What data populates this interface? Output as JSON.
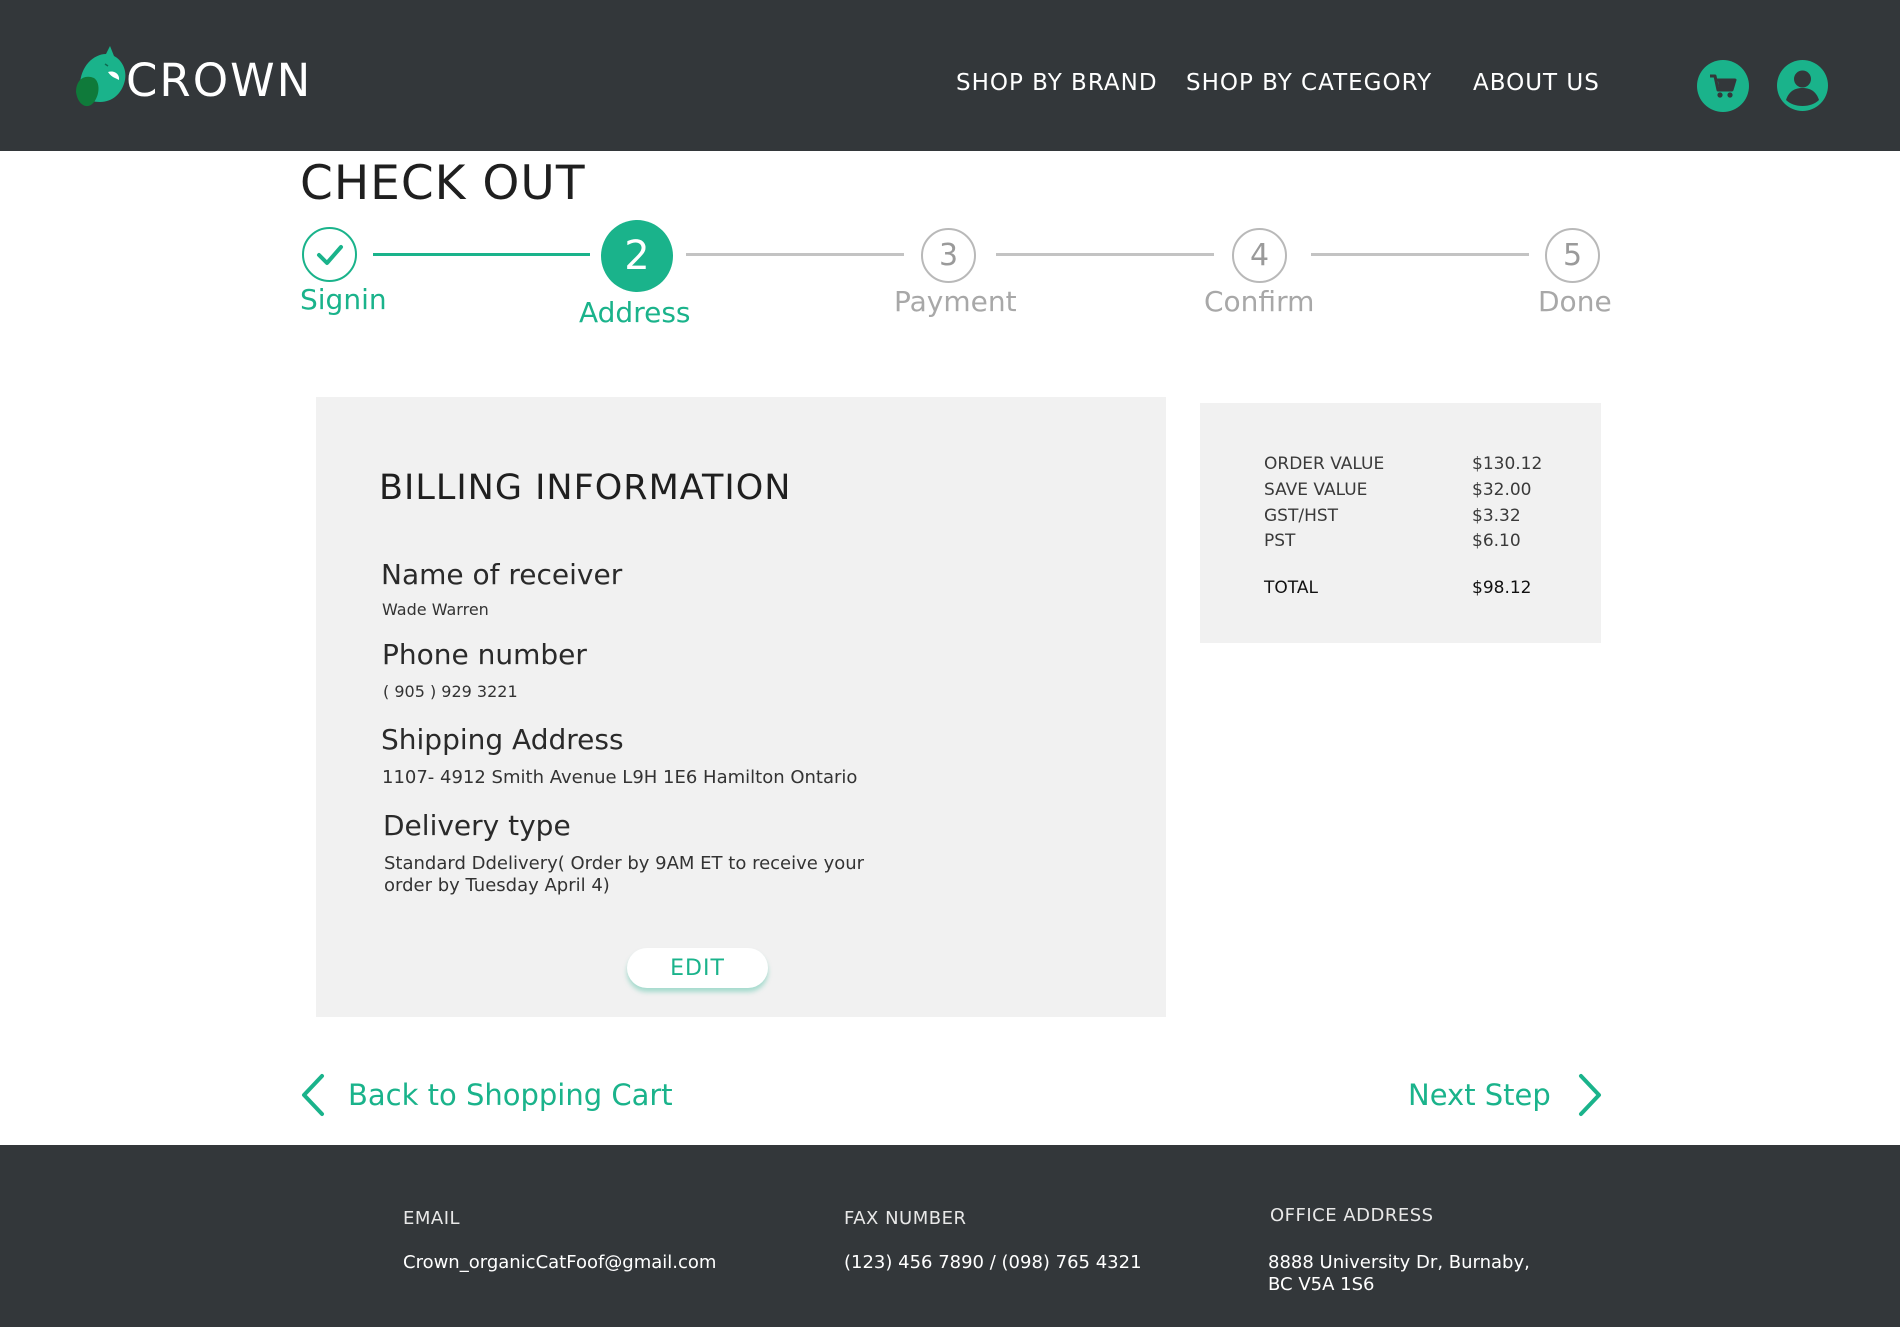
{
  "header": {
    "brand": "CROWN",
    "nav": {
      "shop_by_brand": "SHOP BY BRAND",
      "shop_by_category": "SHOP BY CATEGORY",
      "about_us": "ABOUT US"
    },
    "icons": [
      "cart-icon",
      "user-icon"
    ]
  },
  "checkout": {
    "title": "CHECK OUT",
    "steps": [
      {
        "number": "",
        "label": "Signin",
        "status": "completed"
      },
      {
        "number": "2",
        "label": "Address",
        "status": "current"
      },
      {
        "number": "3",
        "label": "Payment",
        "status": "upcoming"
      },
      {
        "number": "4",
        "label": "Confirm",
        "status": "upcoming"
      },
      {
        "number": "5",
        "label": "Done",
        "status": "upcoming"
      }
    ]
  },
  "billing": {
    "title": "BILLING INFORMATION",
    "name_label": "Name of receiver",
    "name_value": "Wade Warren",
    "phone_label": "Phone number",
    "phone_value": "( 905 ) 929 3221",
    "shipping_label": "Shipping Address",
    "shipping_value": "1107- 4912  Smith Avenue L9H 1E6 Hamilton Ontario",
    "delivery_label": "Delivery type",
    "delivery_value": "Standard Ddelivery( Order by 9AM ET to receive your order by Tuesday April 4)",
    "edit_label": "EDIT"
  },
  "summary": {
    "rows": [
      {
        "label": "ORDER VALUE",
        "value": "$130.12"
      },
      {
        "label": "SAVE VALUE",
        "value": "$32.00"
      },
      {
        "label": "GST/HST",
        "value": "$3.32"
      },
      {
        "label": "PST",
        "value": "$6.10"
      }
    ],
    "total_label": "TOTAL",
    "total_value": "$98.12"
  },
  "navigation": {
    "back_label": "Back to Shopping Cart",
    "next_label": "Next Step"
  },
  "footer": {
    "email_heading": "EMAIL",
    "email_value": "Crown_organicCatFoof@gmail.com",
    "fax_heading": "FAX NUMBER",
    "fax_value": "(123) 456 7890 / (098) 765 4321",
    "office_heading": "OFFICE ADDRESS",
    "office_line1": "8888 University Dr, Burnaby,",
    "office_line2": "BC V5A 1S6"
  },
  "colors": {
    "accent": "#1ab38b",
    "header_bg": "#33373a",
    "panel_bg": "#f1f1f1",
    "inactive": "#a8a8a8"
  }
}
